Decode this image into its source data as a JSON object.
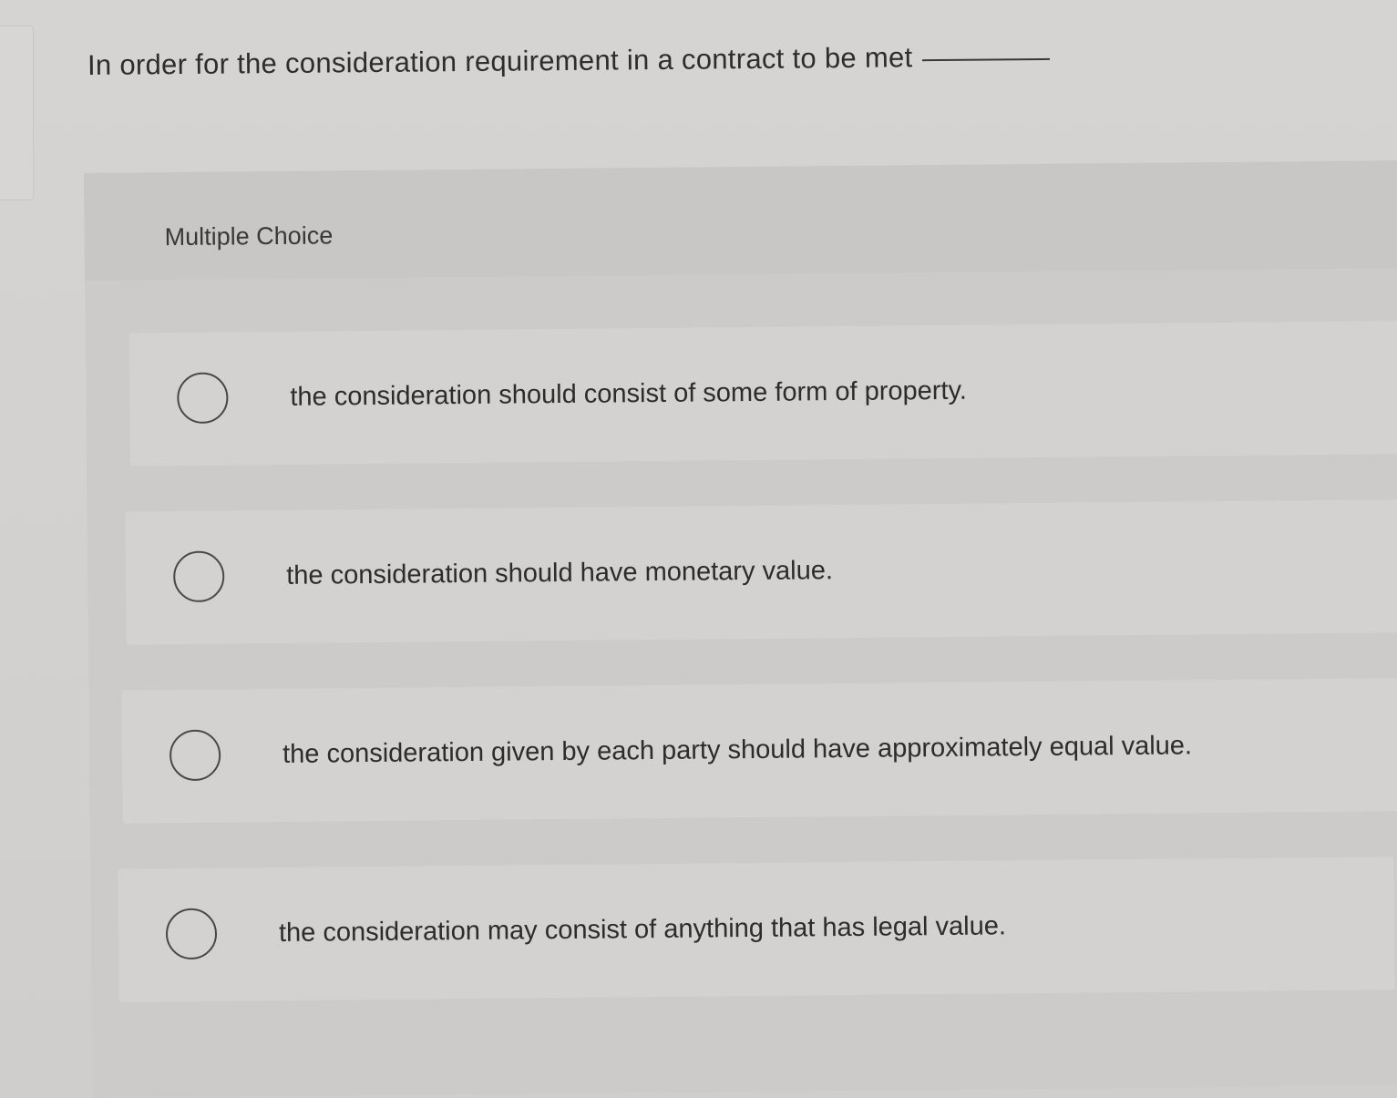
{
  "question": {
    "text": "In order for the consideration requirement in a contract to be met"
  },
  "multiple_choice": {
    "label": "Multiple Choice",
    "options": [
      {
        "text": "the consideration should consist of some form of property."
      },
      {
        "text": "the consideration should have monetary value."
      },
      {
        "text": "the consideration given by each party should have approximately equal value."
      },
      {
        "text": "the consideration may consist of anything that has legal value."
      }
    ]
  }
}
